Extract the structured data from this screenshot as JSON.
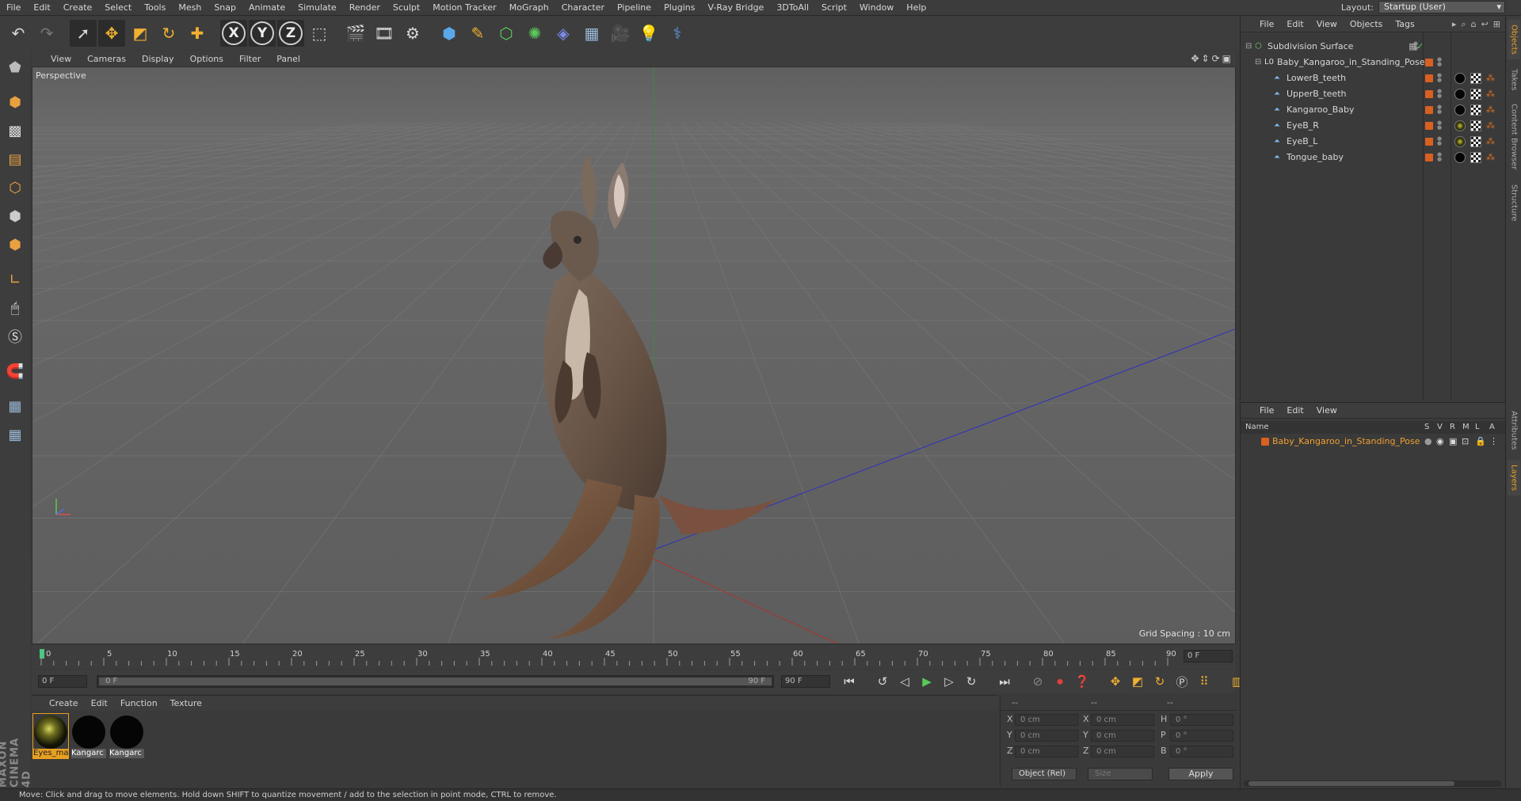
{
  "menu": [
    "File",
    "Edit",
    "Create",
    "Select",
    "Tools",
    "Mesh",
    "Snap",
    "Animate",
    "Simulate",
    "Render",
    "Sculpt",
    "Motion Tracker",
    "MoGraph",
    "Character",
    "Pipeline",
    "Plugins",
    "V-Ray Bridge",
    "3DToAll",
    "Script",
    "Window",
    "Help"
  ],
  "layout": {
    "label": "Layout:",
    "value": "Startup (User)"
  },
  "toolbar": {
    "axis_x": "X",
    "axis_y": "Y",
    "axis_z": "Z"
  },
  "viewport": {
    "menu": [
      "View",
      "Cameras",
      "Display",
      "Options",
      "Filter",
      "Panel"
    ],
    "label": "Perspective",
    "grid_spacing": "Grid Spacing : 10 cm"
  },
  "timeline": {
    "ticks": [
      "0",
      "5",
      "10",
      "15",
      "20",
      "25",
      "30",
      "35",
      "40",
      "45",
      "50",
      "55",
      "60",
      "65",
      "70",
      "75",
      "80",
      "85",
      "90"
    ],
    "current_frame": "0 F",
    "start_field": "0 F",
    "range_start": "0 F",
    "range_end": "90 F",
    "end_field": "90 F"
  },
  "materials": {
    "menu": [
      "Create",
      "Edit",
      "Function",
      "Texture"
    ],
    "items": [
      {
        "label": "Eyes_ma",
        "type": "eye",
        "selected": true
      },
      {
        "label": "Kangarc",
        "type": "black",
        "selected": false
      },
      {
        "label": "Kangarc",
        "type": "black",
        "selected": false
      }
    ]
  },
  "coordinates": {
    "head": [
      "--",
      "--",
      "--"
    ],
    "rows": [
      {
        "l1": "X",
        "v1": "0 cm",
        "l2": "X",
        "v2": "0 cm",
        "l3": "H",
        "v3": "0 °"
      },
      {
        "l1": "Y",
        "v1": "0 cm",
        "l2": "Y",
        "v2": "0 cm",
        "l3": "P",
        "v3": "0 °"
      },
      {
        "l1": "Z",
        "v1": "0 cm",
        "l2": "Z",
        "v2": "0 cm",
        "l3": "B",
        "v3": "0 °"
      }
    ],
    "mode": "Object (Rel)",
    "size": "Size",
    "apply": "Apply"
  },
  "object_manager": {
    "menu": [
      "File",
      "Edit",
      "View",
      "Objects",
      "Tags"
    ],
    "objects": [
      {
        "name": "Subdivision Surface",
        "indent": 0,
        "icon": "subdivision-icon"
      },
      {
        "name": "Baby_Kangaroo_in_Standing_Pose",
        "indent": 1,
        "icon": "null-icon"
      },
      {
        "name": "LowerB_teeth",
        "indent": 2,
        "icon": "polygon-icon",
        "tag": "black"
      },
      {
        "name": "UpperB_teeth",
        "indent": 2,
        "icon": "polygon-icon",
        "tag": "black"
      },
      {
        "name": "Kangaroo_Baby",
        "indent": 2,
        "icon": "polygon-icon",
        "tag": "black"
      },
      {
        "name": "EyeB_R",
        "indent": 2,
        "icon": "polygon-icon",
        "tag": "eye"
      },
      {
        "name": "EyeB_L",
        "indent": 2,
        "icon": "polygon-icon",
        "tag": "eye"
      },
      {
        "name": "Tongue_baby",
        "indent": 2,
        "icon": "polygon-icon",
        "tag": "black"
      }
    ]
  },
  "layer_manager": {
    "menu": [
      "File",
      "Edit",
      "View"
    ],
    "columns": [
      "Name",
      "S",
      "V",
      "R",
      "M",
      "L",
      "A"
    ],
    "layer": "Baby_Kangaroo_in_Standing_Pose"
  },
  "side_tabs": [
    "Objects",
    "Takes",
    "Content Browser",
    "Structure",
    "Attributes",
    "Layers"
  ],
  "status": "Move: Click and drag to move elements. Hold down SHIFT to quantize movement / add to the selection in point mode, CTRL to remove."
}
